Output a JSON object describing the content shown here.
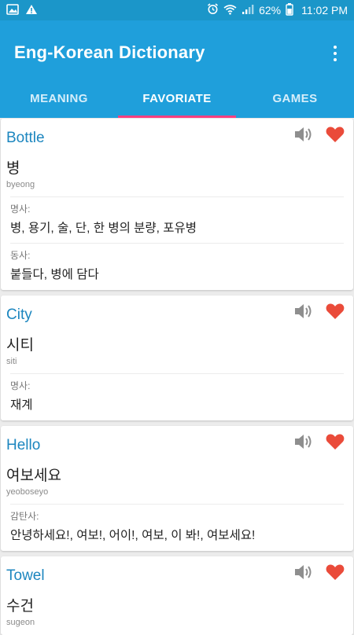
{
  "status_bar": {
    "battery": "62%",
    "time": "11:02 PM",
    "left_icons": [
      "image-icon",
      "warning-icon"
    ],
    "right_icons": [
      "alarm-icon",
      "wifi-icon",
      "signal-icon",
      "battery-icon"
    ]
  },
  "app_bar": {
    "title": "Eng-Korean Dictionary",
    "overflow_icon": "more-vert-icon"
  },
  "tabs": [
    {
      "label": "MEANING",
      "active": false
    },
    {
      "label": "FAVORIATE",
      "active": true
    },
    {
      "label": "GAMES",
      "active": false
    }
  ],
  "colors": {
    "status_bar": "#1b96c9",
    "app_bar": "#1f9fdb",
    "tab_indicator": "#ff3f7f",
    "word": "#1c86bf",
    "heart": "#ea4b3a",
    "speaker": "#8e8e8e"
  },
  "entries": [
    {
      "word": "Bottle",
      "korean": "병",
      "romanization": "byeong",
      "senses": [
        {
          "pos": "명사:",
          "meaning": "병, 용기, 술, 단, 한 병의 분량, 포유병"
        },
        {
          "pos": "동사:",
          "meaning": "붙들다, 병에 담다"
        }
      ]
    },
    {
      "word": "City",
      "korean": "시티",
      "romanization": "siti",
      "senses": [
        {
          "pos": "명사:",
          "meaning": "재계"
        }
      ]
    },
    {
      "word": "Hello",
      "korean": "여보세요",
      "romanization": "yeoboseyo",
      "senses": [
        {
          "pos": "감탄사:",
          "meaning": "안녕하세요!, 여보!, 어이!, 여보, 이 봐!, 여보세요!"
        }
      ]
    },
    {
      "word": "Towel",
      "korean": "수건",
      "romanization": "sugeon",
      "senses": []
    }
  ]
}
